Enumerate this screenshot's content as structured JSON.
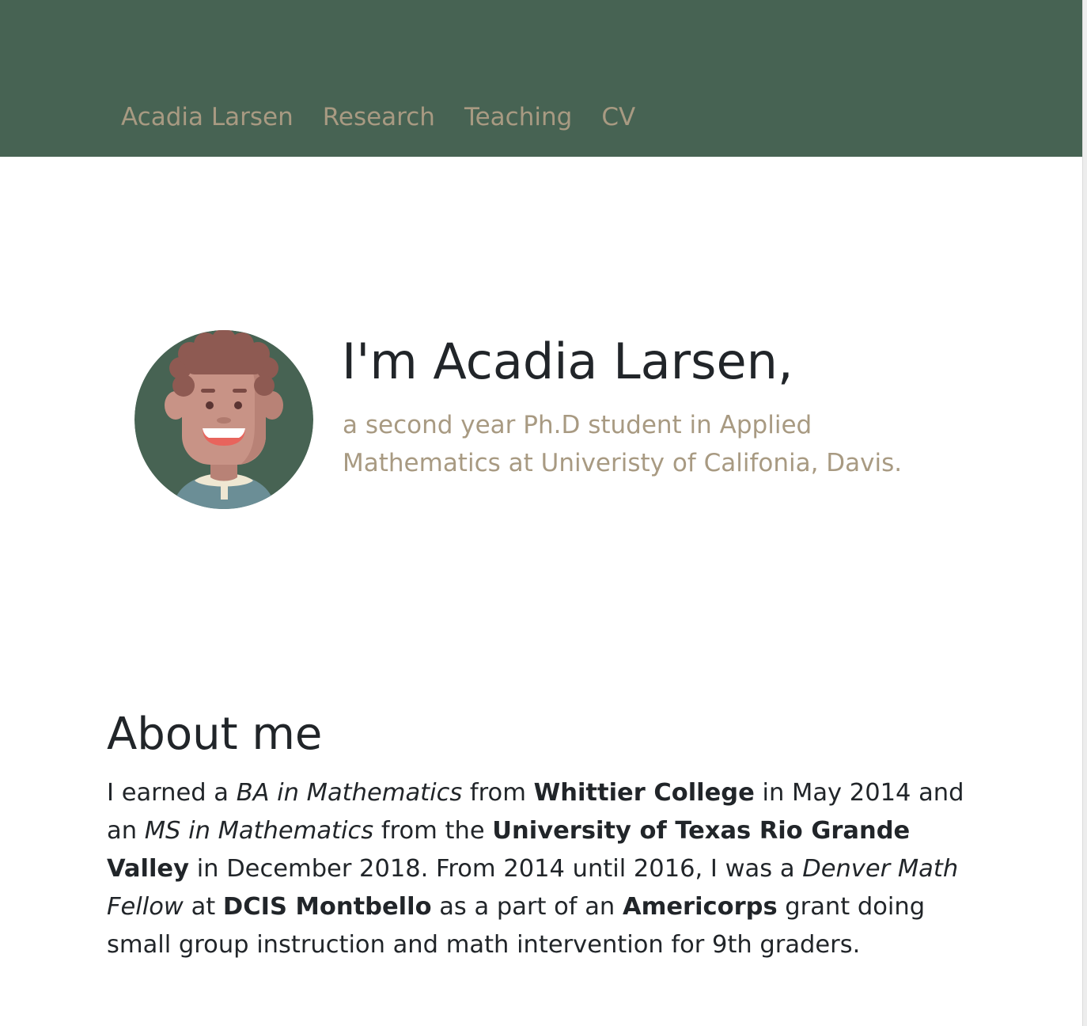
{
  "nav": {
    "brand": "Acadia Larsen",
    "links": [
      "Research",
      "Teaching",
      "CV"
    ]
  },
  "hero": {
    "title": "I'm Acadia Larsen,",
    "subtitle": "a second year Ph.D student in Applied Mathematics at Univeristy of Califonia, Davis.",
    "avatar_icon": "smiling-person-avatar-icon"
  },
  "about": {
    "heading": "About me",
    "segments": [
      {
        "text": "I earned a ",
        "style": "normal"
      },
      {
        "text": "BA in Mathematics",
        "style": "italic"
      },
      {
        "text": " from ",
        "style": "normal"
      },
      {
        "text": "Whittier College",
        "style": "bold"
      },
      {
        "text": " in May 2014 and an ",
        "style": "normal"
      },
      {
        "text": "MS in Mathematics",
        "style": "italic"
      },
      {
        "text": " from the ",
        "style": "normal"
      },
      {
        "text": "University of Texas Rio Grande Valley",
        "style": "bold"
      },
      {
        "text": " in December 2018. From 2014 until 2016, I was a ",
        "style": "normal"
      },
      {
        "text": "Denver Math Fellow",
        "style": "italic"
      },
      {
        "text": " at ",
        "style": "normal"
      },
      {
        "text": "DCIS Montbello",
        "style": "bold"
      },
      {
        "text": " as a part of an ",
        "style": "normal"
      },
      {
        "text": "Americorps",
        "style": "bold"
      },
      {
        "text": " grant doing small group instruction and math intervention for 9th graders.",
        "style": "normal"
      }
    ]
  },
  "colors": {
    "navbar_bg": "#476353",
    "nav_link": "#a89a82",
    "subtitle": "#a89a82",
    "text": "#212529"
  }
}
